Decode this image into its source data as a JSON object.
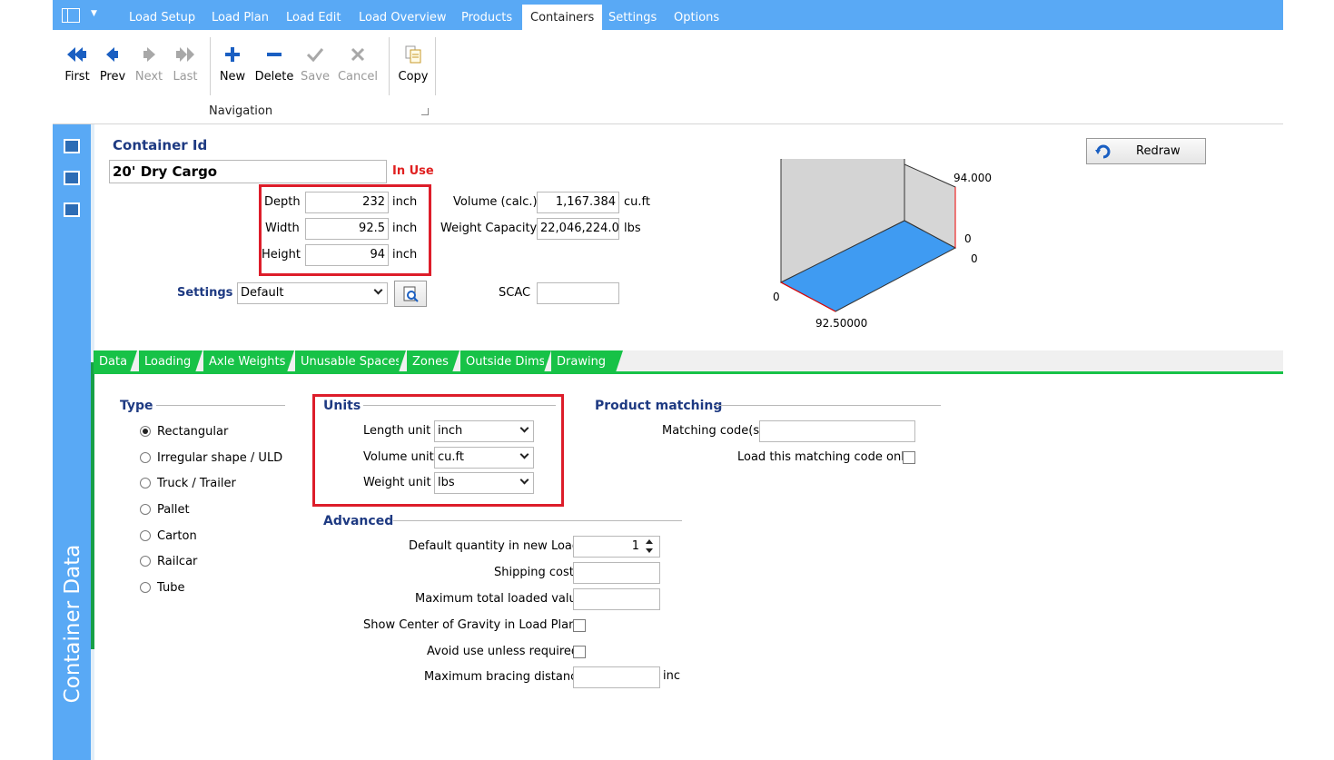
{
  "menu": {
    "tabs": [
      "Load Setup",
      "Load Plan",
      "Load Edit",
      "Load Overview",
      "Products",
      "Containers",
      "Settings",
      "Options"
    ],
    "active": "Containers"
  },
  "ribbon": {
    "first": "First",
    "prev": "Prev",
    "next": "Next",
    "last": "Last",
    "new": "New",
    "delete": "Delete",
    "save": "Save",
    "cancel": "Cancel",
    "copy": "Copy",
    "group_label": "Navigation"
  },
  "sidebar": {
    "title": "Container Data",
    "icons": [
      "tree-view-icon",
      "list-view-icon",
      "image-view-icon"
    ]
  },
  "container": {
    "id_label": "Container Id",
    "id_value": "20' Dry Cargo",
    "status": "In Use",
    "depth_label": "Depth",
    "depth_value": "232",
    "width_label": "Width",
    "width_value": "92.5",
    "height_label": "Height",
    "height_value": "94",
    "dim_unit": "inch",
    "volume_label": "Volume (calc.)",
    "volume_value": "1,167.384",
    "volume_unit": "cu.ft",
    "weight_label": "Weight Capacity",
    "weight_value": "22,046,224.0",
    "weight_unit": "lbs",
    "settings_label": "Settings",
    "settings_value": "Default",
    "scac_label": "SCAC",
    "scac_value": ""
  },
  "drawing": {
    "redraw": "Redraw",
    "label_height": "94.000",
    "label_zero_a": "0",
    "label_zero_b": "0",
    "label_zero_c": "0",
    "label_width": "92.50000",
    "colors": {
      "floor": "#3f9bf2",
      "wall": "#d4d4d4"
    }
  },
  "tabs": [
    "Data",
    "Loading",
    "Axle Weights",
    "Unusable Spaces",
    "Zones",
    "Outside Dims",
    "Drawing"
  ],
  "type": {
    "title": "Type",
    "options": [
      "Rectangular",
      "Irregular shape / ULD",
      "Truck / Trailer",
      "Pallet",
      "Carton",
      "Railcar",
      "Tube"
    ],
    "selected": "Rectangular"
  },
  "units": {
    "title": "Units",
    "length_label": "Length unit",
    "length_value": "inch",
    "volume_label": "Volume unit",
    "volume_value": "cu.ft",
    "weight_label": "Weight unit",
    "weight_value": "lbs"
  },
  "matching": {
    "title": "Product matching",
    "codes_label": "Matching code(s)",
    "codes_value": "",
    "only_label": "Load this matching code only"
  },
  "advanced": {
    "title": "Advanced",
    "default_qty_label": "Default quantity in new Load",
    "default_qty_value": "1",
    "shipping_label": "Shipping cost",
    "shipping_value": "",
    "max_value_label": "Maximum total loaded value",
    "max_value_value": "",
    "cog_label": "Show Center of Gravity in Load Plans",
    "avoid_label": "Avoid use unless required",
    "bracing_label": "Maximum bracing distance",
    "bracing_value": "",
    "bracing_unit": "inch"
  },
  "colors": {
    "accent": "#59a9f5",
    "tab_green": "#17c247",
    "highlight": "#dd1d2a",
    "label_blue": "#1e3a82"
  }
}
